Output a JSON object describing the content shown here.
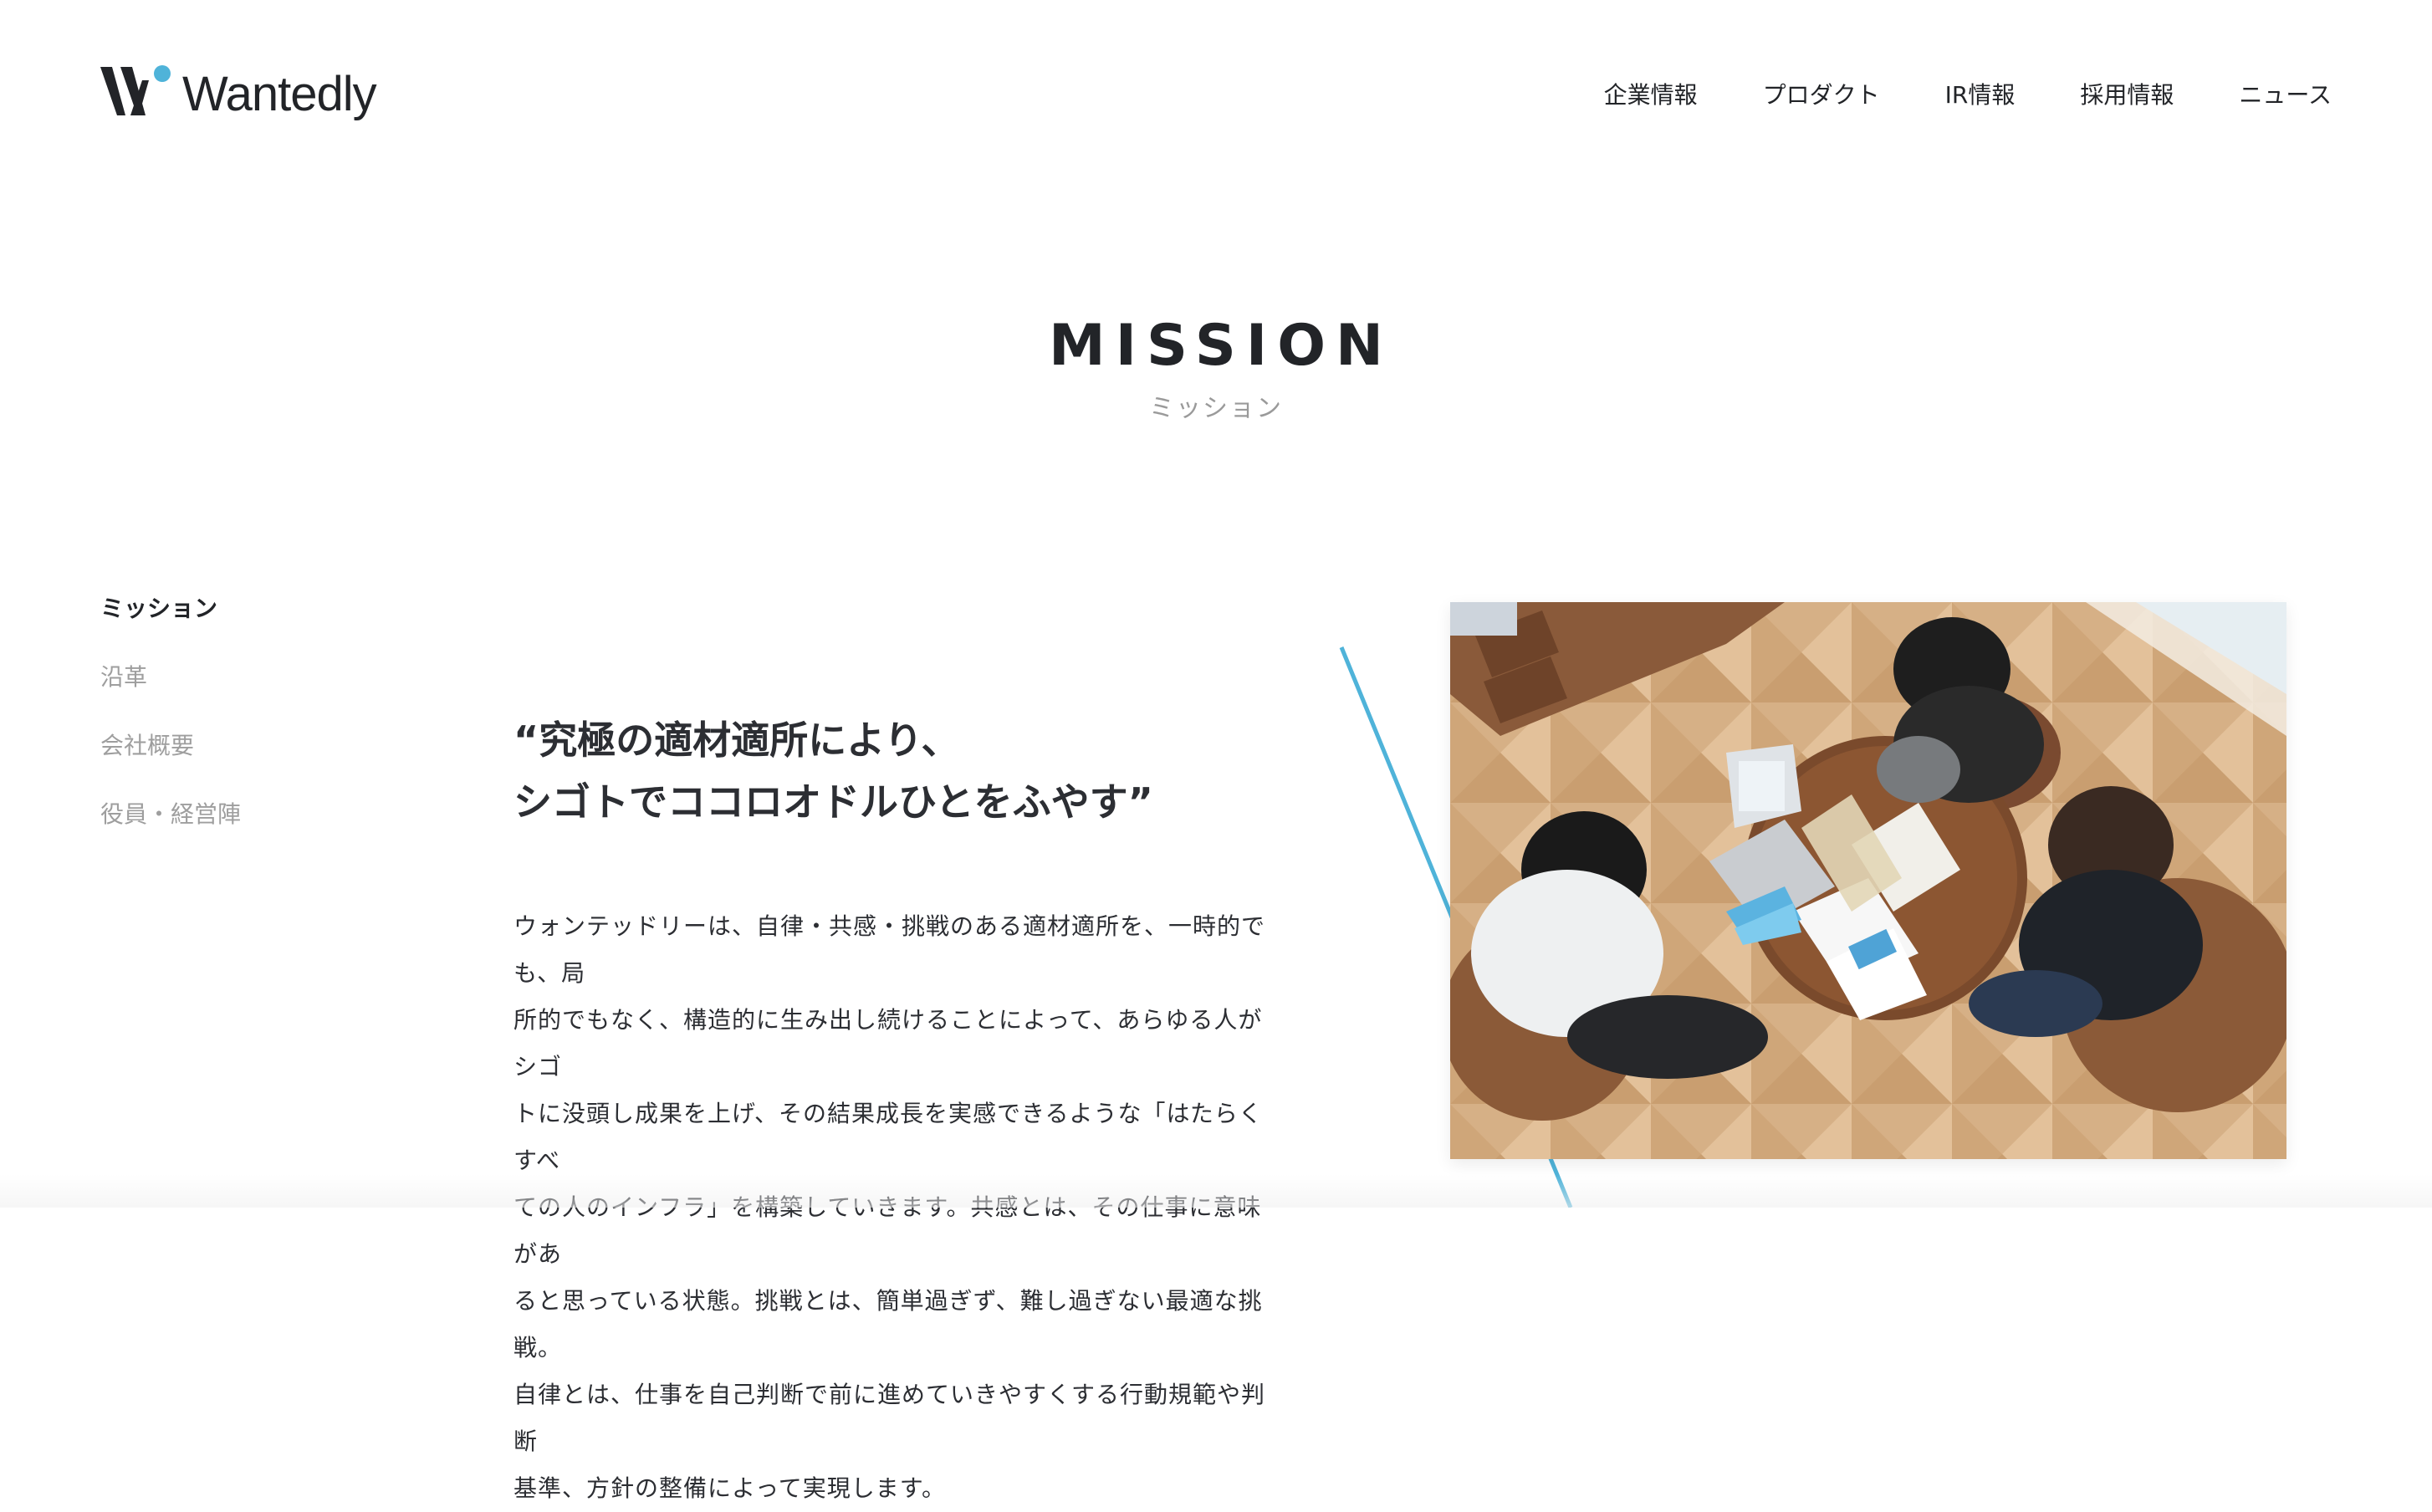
{
  "header": {
    "logo_text": "Wantedly",
    "nav": [
      {
        "label": "企業情報"
      },
      {
        "label": "プロダクト"
      },
      {
        "label": "IR情報"
      },
      {
        "label": "採用情報"
      },
      {
        "label": "ニュース"
      }
    ]
  },
  "section": {
    "title_en": "MISSION",
    "title_ja": "ミッション"
  },
  "side_nav": {
    "items": [
      {
        "label": "ミッション",
        "active": true
      },
      {
        "label": "沿革",
        "active": false
      },
      {
        "label": "会社概要",
        "active": false
      },
      {
        "label": "役員・経営陣",
        "active": false
      }
    ]
  },
  "mission": {
    "quote_line1": "“究極の適材適所により、",
    "quote_line2": "シゴトでココロオドルひとをふやす”",
    "body_lines": [
      "ウォンテッドリーは、自律・共感・挑戦のある適材適所を、一時的でも、局",
      "所的でもなく、構造的に生み出し続けることによって、あらゆる人がシゴ",
      "トに没頭し成果を上げ、その結果成長を実感できるような「はたらくすべ",
      "ての人のインフラ」を構築していきます。共感とは、その仕事に意味があ",
      "ると思っている状態。挑戦とは、簡単過ぎず、難し過ぎない最適な挑戦。",
      "自律とは、仕事を自己判断で前に進めていきやすくする行動規範や判断",
      "基準、方針の整備によって実現します。"
    ]
  },
  "colors": {
    "brand_blue": "#4fb3d9",
    "text_dark": "#222428",
    "text_muted": "#9e9e9e"
  },
  "icons": {
    "logo_mark": "wantedly-w-logo-icon"
  }
}
